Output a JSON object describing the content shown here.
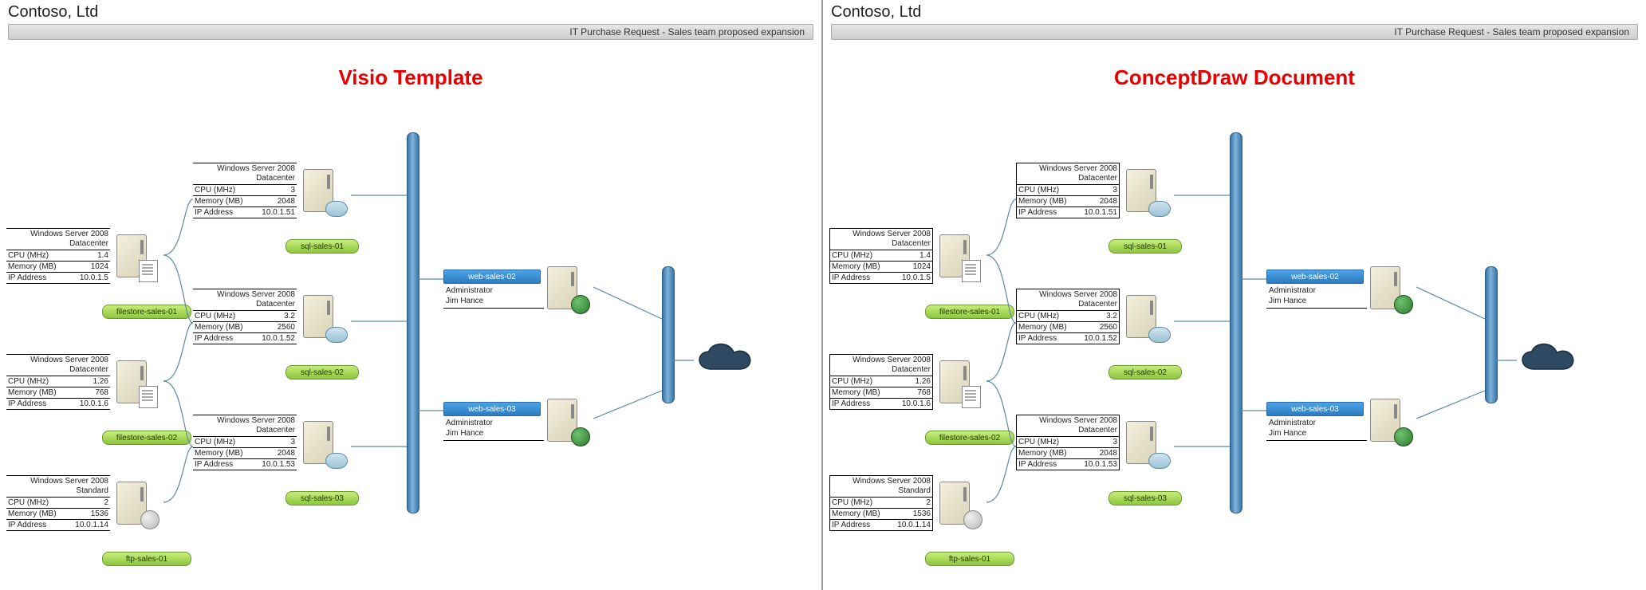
{
  "header": {
    "company": "Contoso, Ltd",
    "subtitle": "IT Purchase Request - Sales team proposed expansion"
  },
  "panes": [
    {
      "title": "Visio Template",
      "boxed": false
    },
    {
      "title": "ConceptDraw Document",
      "boxed": true
    }
  ],
  "filestores": [
    {
      "os": "Windows Server 2008\nDatacenter",
      "cpu_label": "CPU (MHz)",
      "cpu": "1.4",
      "mem_label": "Memory (MB)",
      "mem": "1024",
      "ip_label": "IP Address",
      "ip": "10.0.1.5",
      "name": "filestore-sales-01"
    },
    {
      "os": "Windows Server 2008\nDatacenter",
      "cpu_label": "CPU (MHz)",
      "cpu": "1.26",
      "mem_label": "Memory (MB)",
      "mem": "768",
      "ip_label": "IP Address",
      "ip": "10.0.1.6",
      "name": "filestore-sales-02"
    },
    {
      "os": "Windows Server 2008\nStandard",
      "cpu_label": "CPU (MHz)",
      "cpu": "2",
      "mem_label": "Memory (MB)",
      "mem": "1536",
      "ip_label": "IP Address",
      "ip": "10.0.1.14",
      "name": "ftp-sales-01"
    }
  ],
  "sqls": [
    {
      "os": "Windows Server 2008\nDatacenter",
      "cpu_label": "CPU (MHz)",
      "cpu": "3",
      "mem_label": "Memory (MB)",
      "mem": "2048",
      "ip_label": "IP Address",
      "ip": "10.0.1.51",
      "name": "sql-sales-01"
    },
    {
      "os": "Windows Server 2008\nDatacenter",
      "cpu_label": "CPU (MHz)",
      "cpu": "3.2",
      "mem_label": "Memory (MB)",
      "mem": "2560",
      "ip_label": "IP Address",
      "ip": "10.0.1.52",
      "name": "sql-sales-02"
    },
    {
      "os": "Windows Server 2008\nDatacenter",
      "cpu_label": "CPU (MHz)",
      "cpu": "3",
      "mem_label": "Memory (MB)",
      "mem": "2048",
      "ip_label": "IP Address",
      "ip": "10.0.1.53",
      "name": "sql-sales-03"
    }
  ],
  "webs": [
    {
      "name": "web-sales-02",
      "admin_label": "Administrator",
      "admin": "Jim Hance"
    },
    {
      "name": "web-sales-03",
      "admin_label": "Administrator",
      "admin": "Jim Hance"
    }
  ],
  "colors": {
    "accent_red": "#e70000",
    "badge_green": "#8cc63f",
    "web_blue": "#3a8cd0",
    "pipe_blue": "#5a93bf"
  }
}
